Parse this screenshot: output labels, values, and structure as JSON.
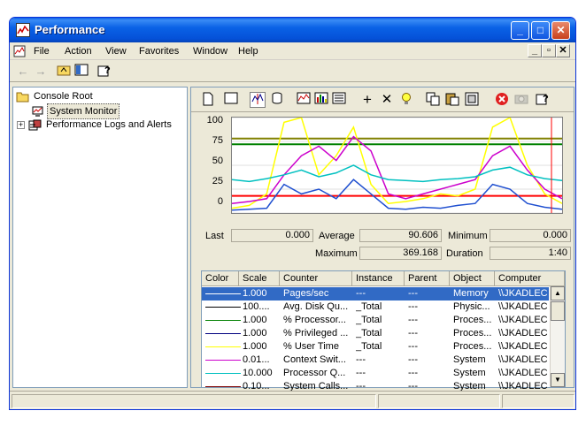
{
  "window": {
    "title": "Performance"
  },
  "menubar": {
    "items": [
      "File",
      "Action",
      "View",
      "Favorites",
      "Window",
      "Help"
    ],
    "mdi": [
      "_",
      "▫",
      "✕"
    ]
  },
  "tree": {
    "root": "Console Root",
    "items": [
      "System Monitor",
      "Performance Logs and Alerts"
    ],
    "expand_glyph": "+"
  },
  "graph": {
    "y_ticks": [
      "100",
      "75",
      "50",
      "25",
      "0"
    ],
    "ylim": [
      0,
      100
    ],
    "duration_seconds": 100
  },
  "stats": {
    "last_label": "Last",
    "last": "0.000",
    "average_label": "Average",
    "average": "90.606",
    "minimum_label": "Minimum",
    "minimum": "0.000",
    "maximum_label": "Maximum",
    "maximum": "369.168",
    "duration_label": "Duration",
    "duration": "1:40"
  },
  "legend": {
    "columns": [
      "Color",
      "Scale",
      "Counter",
      "Instance",
      "Parent",
      "Object",
      "Computer"
    ],
    "rows": [
      {
        "color": "#2050d0",
        "scale": "1.000",
        "counter": "Pages/sec",
        "instance": "---",
        "parent": "---",
        "object": "Memory",
        "computer": "\\\\JKADLEC"
      },
      {
        "color": "#000000",
        "scale": "100....",
        "counter": "Avg. Disk Qu...",
        "instance": "_Total",
        "parent": "---",
        "object": "Physic...",
        "computer": "\\\\JKADLEC"
      },
      {
        "color": "#008000",
        "scale": "1.000",
        "counter": "% Processor...",
        "instance": "_Total",
        "parent": "---",
        "object": "Proces...",
        "computer": "\\\\JKADLEC"
      },
      {
        "color": "#000080",
        "scale": "1.000",
        "counter": "% Privileged ...",
        "instance": "_Total",
        "parent": "---",
        "object": "Proces...",
        "computer": "\\\\JKADLEC"
      },
      {
        "color": "#ffff00",
        "scale": "1.000",
        "counter": "% User Time",
        "instance": "_Total",
        "parent": "---",
        "object": "Proces...",
        "computer": "\\\\JKADLEC"
      },
      {
        "color": "#cc00cc",
        "scale": "0.01...",
        "counter": "Context Swit...",
        "instance": "---",
        "parent": "---",
        "object": "System",
        "computer": "\\\\JKADLEC"
      },
      {
        "color": "#00c0c0",
        "scale": "10.000",
        "counter": "Processor Q...",
        "instance": "---",
        "parent": "---",
        "object": "System",
        "computer": "\\\\JKADLEC"
      },
      {
        "color": "#800000",
        "scale": "0.10...",
        "counter": "System Calls...",
        "instance": "---",
        "parent": "---",
        "object": "System",
        "computer": "\\\\JKADLEC"
      }
    ]
  },
  "chart_data": {
    "type": "line",
    "ylim": [
      0,
      100
    ],
    "grid": true,
    "series": [
      {
        "color": "#ff0000",
        "values": [
          18,
          18,
          18,
          18,
          18,
          18,
          18,
          18,
          18,
          18,
          18,
          18,
          18,
          18,
          18,
          18,
          18,
          18,
          18,
          18
        ]
      },
      {
        "color": "#008000",
        "values": [
          72,
          72,
          72,
          72,
          72,
          72,
          72,
          72,
          72,
          72,
          72,
          72,
          72,
          72,
          72,
          72,
          72,
          72,
          72,
          72
        ]
      },
      {
        "color": "#808000",
        "values": [
          78,
          78,
          78,
          78,
          78,
          78,
          78,
          78,
          78,
          78,
          78,
          78,
          78,
          78,
          78,
          78,
          78,
          78,
          78,
          78
        ]
      },
      {
        "color": "#ffff00",
        "values": [
          5,
          8,
          20,
          95,
          100,
          40,
          60,
          90,
          30,
          10,
          12,
          15,
          20,
          18,
          25,
          90,
          100,
          50,
          20,
          10
        ]
      },
      {
        "color": "#cc00cc",
        "values": [
          10,
          12,
          15,
          40,
          60,
          70,
          55,
          80,
          65,
          20,
          15,
          20,
          25,
          30,
          35,
          60,
          70,
          45,
          25,
          15
        ]
      },
      {
        "color": "#2050d0",
        "values": [
          3,
          4,
          5,
          30,
          20,
          25,
          15,
          35,
          20,
          5,
          4,
          6,
          5,
          8,
          10,
          30,
          25,
          10,
          6,
          4
        ]
      },
      {
        "color": "#00c0c0",
        "values": [
          35,
          33,
          36,
          40,
          45,
          38,
          42,
          50,
          40,
          35,
          34,
          33,
          35,
          36,
          38,
          45,
          48,
          40,
          36,
          34
        ]
      }
    ]
  }
}
